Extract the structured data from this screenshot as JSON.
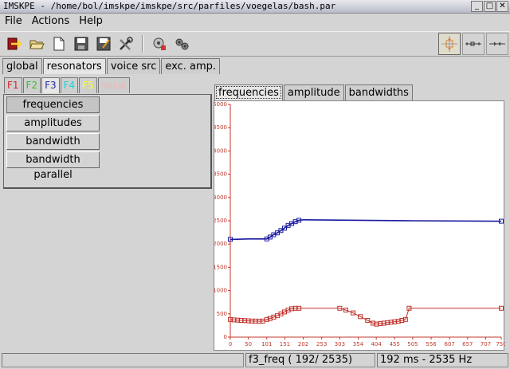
{
  "window": {
    "title": "IMSKPE - /home/bol/imskpe/imskpe/src/parfiles/voegelas/bash.par",
    "buttons": [
      "_",
      "□",
      "✕"
    ]
  },
  "menu": [
    "File",
    "Actions",
    "Help"
  ],
  "toolbar": {
    "icons": [
      "exit-icon",
      "open-folder-icon",
      "new-file-icon",
      "save-icon",
      "save-as-icon",
      "tools-icon",
      "generate-sound-icon",
      "play-icon"
    ],
    "view_icons": [
      "crosshair-select-icon",
      "line-edit-icon",
      "line-draw-icon"
    ]
  },
  "main_tabs": [
    "global",
    "resonators",
    "voice src",
    "exc. amp."
  ],
  "formant_tabs": [
    {
      "label": "F1",
      "color": "#d8202a"
    },
    {
      "label": "F2",
      "color": "#33c233"
    },
    {
      "label": "F3",
      "color": "#2a2aaa"
    },
    {
      "label": "F4",
      "color": "#22d0d0"
    },
    {
      "label": "F5",
      "color": "#ffff20"
    },
    {
      "label": "nasal",
      "color": "#e8b8b8"
    }
  ],
  "panel_buttons": [
    "frequencies",
    "amplitudes",
    "bandwidth",
    "bandwidth parallel"
  ],
  "plot_tabs": [
    "frequencies",
    "amplitude",
    "bandwidths"
  ],
  "chart_data": {
    "type": "line",
    "y_ticks": [
      0,
      500,
      1000,
      1500,
      2000,
      2500,
      3000,
      3500,
      4000,
      4500,
      5000
    ],
    "x_ticks": [
      0,
      50,
      101,
      151,
      202,
      253,
      303,
      354,
      404,
      455,
      505,
      556,
      607,
      657,
      707,
      750
    ],
    "xlim": [
      0,
      750
    ],
    "ylim": [
      0,
      5000
    ],
    "series": [
      {
        "color": "#1a1aa0",
        "points": [
          [
            0,
            2100
          ],
          [
            50,
            2110
          ],
          [
            101,
            2110
          ],
          [
            110,
            2150
          ],
          [
            120,
            2200
          ],
          [
            130,
            2240
          ],
          [
            140,
            2290
          ],
          [
            150,
            2340
          ],
          [
            160,
            2400
          ],
          [
            170,
            2440
          ],
          [
            180,
            2480
          ],
          [
            190,
            2510
          ],
          [
            202,
            2520
          ],
          [
            505,
            2500
          ],
          [
            750,
            2490
          ]
        ],
        "markers_x": [
          0,
          101,
          110,
          120,
          130,
          140,
          150,
          160,
          170,
          180,
          190,
          750
        ]
      },
      {
        "color": "#c0302b",
        "points": [
          [
            0,
            380
          ],
          [
            10,
            370
          ],
          [
            20,
            365
          ],
          [
            30,
            360
          ],
          [
            40,
            355
          ],
          [
            50,
            350
          ],
          [
            60,
            345
          ],
          [
            70,
            345
          ],
          [
            80,
            340
          ],
          [
            90,
            345
          ],
          [
            101,
            380
          ],
          [
            110,
            400
          ],
          [
            120,
            430
          ],
          [
            130,
            460
          ],
          [
            140,
            500
          ],
          [
            150,
            540
          ],
          [
            160,
            580
          ],
          [
            170,
            610
          ],
          [
            180,
            620
          ],
          [
            190,
            620
          ],
          [
            303,
            620
          ],
          [
            320,
            580
          ],
          [
            340,
            520
          ],
          [
            360,
            440
          ],
          [
            380,
            360
          ],
          [
            395,
            300
          ],
          [
            405,
            280
          ],
          [
            415,
            290
          ],
          [
            425,
            300
          ],
          [
            435,
            310
          ],
          [
            445,
            320
          ],
          [
            455,
            330
          ],
          [
            465,
            340
          ],
          [
            475,
            360
          ],
          [
            485,
            380
          ],
          [
            495,
            620
          ],
          [
            750,
            620
          ]
        ],
        "markers_x": [
          0,
          10,
          20,
          30,
          40,
          50,
          60,
          70,
          80,
          90,
          101,
          110,
          120,
          130,
          140,
          150,
          160,
          170,
          180,
          190,
          303,
          320,
          340,
          360,
          380,
          395,
          405,
          415,
          425,
          435,
          445,
          455,
          465,
          475,
          485,
          495,
          750
        ]
      }
    ]
  },
  "status": {
    "left": "",
    "param": "f3_freq  ( 192/ 2535)",
    "info": "192 ms - 2535 Hz"
  }
}
